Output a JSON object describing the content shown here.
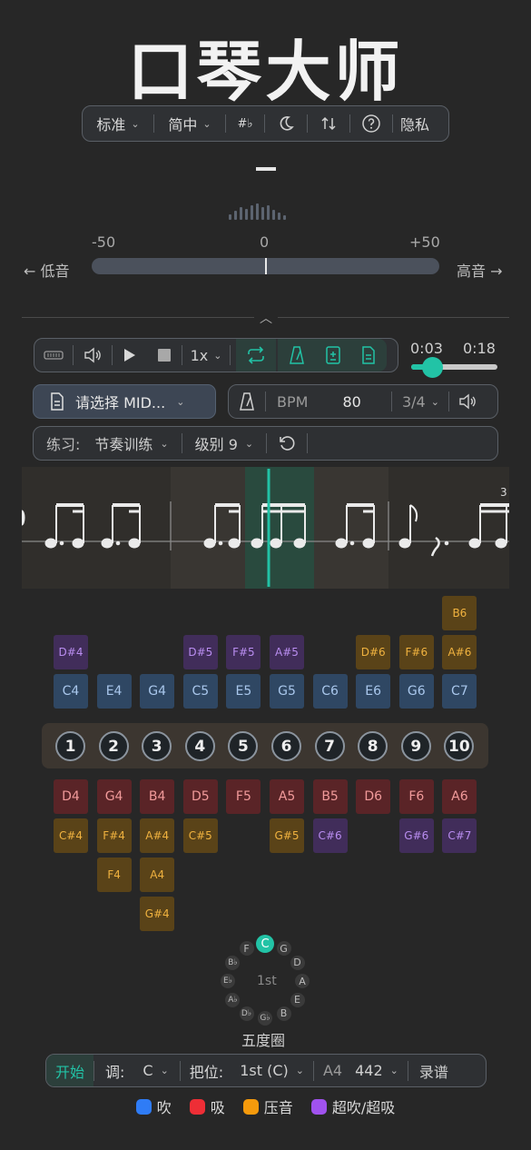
{
  "app": {
    "title": "口琴大师"
  },
  "topbar": {
    "harmonica_type": "标准",
    "language": "简中",
    "accidental_icon": "#♭",
    "privacy": "隐私"
  },
  "tuner": {
    "note": "—",
    "cents_min": "-50",
    "cents_mid": "0",
    "cents_max": "+50",
    "low_label": "← 低音",
    "high_label": "高音 →",
    "needle_cents": 0
  },
  "transport": {
    "speed": "1x",
    "time_current": "0:03",
    "time_total": "0:18",
    "progress": 0.17
  },
  "midi": {
    "label": "请选择 MID..."
  },
  "tempo": {
    "bpm_label": "BPM",
    "bpm_value": "80",
    "time_signature": "3/4"
  },
  "practice": {
    "label": "练习:",
    "mode": "节奏训练",
    "level": "级别 9"
  },
  "score": {
    "tuplet_label": "3"
  },
  "keys": {
    "blow": [
      "C4",
      "E4",
      "G4",
      "C5",
      "E5",
      "G5",
      "C6",
      "E6",
      "G6",
      "C7"
    ],
    "draw": [
      "D4",
      "G4",
      "B4",
      "D5",
      "F5",
      "A5",
      "B5",
      "D6",
      "F6",
      "A6"
    ],
    "blow_bends_overblows": [
      {
        "hole": 1,
        "row": 1,
        "note": "D#4",
        "kind": "over"
      },
      {
        "hole": 4,
        "row": 1,
        "note": "D#5",
        "kind": "over"
      },
      {
        "hole": 5,
        "row": 1,
        "note": "F#5",
        "kind": "over"
      },
      {
        "hole": 6,
        "row": 1,
        "note": "A#5",
        "kind": "over"
      },
      {
        "hole": 8,
        "row": 1,
        "note": "D#6",
        "kind": "bend"
      },
      {
        "hole": 9,
        "row": 1,
        "note": "F#6",
        "kind": "bend"
      },
      {
        "hole": 10,
        "row": 1,
        "note": "A#6",
        "kind": "bend"
      },
      {
        "hole": 10,
        "row": 2,
        "note": "B6",
        "kind": "bend"
      }
    ],
    "draw_bends_overdraws": [
      {
        "hole": 1,
        "row": 1,
        "note": "C#4",
        "kind": "bend"
      },
      {
        "hole": 2,
        "row": 1,
        "note": "F#4",
        "kind": "bend"
      },
      {
        "hole": 3,
        "row": 1,
        "note": "A#4",
        "kind": "bend"
      },
      {
        "hole": 4,
        "row": 1,
        "note": "C#5",
        "kind": "bend"
      },
      {
        "hole": 6,
        "row": 1,
        "note": "G#5",
        "kind": "bend"
      },
      {
        "hole": 7,
        "row": 1,
        "note": "C#6",
        "kind": "over"
      },
      {
        "hole": 9,
        "row": 1,
        "note": "G#6",
        "kind": "over"
      },
      {
        "hole": 10,
        "row": 1,
        "note": "C#7",
        "kind": "over"
      },
      {
        "hole": 2,
        "row": 2,
        "note": "F4",
        "kind": "bend"
      },
      {
        "hole": 3,
        "row": 2,
        "note": "A4",
        "kind": "bend"
      },
      {
        "hole": 3,
        "row": 3,
        "note": "G#4",
        "kind": "bend"
      }
    ],
    "holes": [
      "1",
      "2",
      "3",
      "4",
      "5",
      "6",
      "7",
      "8",
      "9",
      "10"
    ]
  },
  "circle_of_fifths": {
    "label": "五度圈",
    "center": "1st",
    "notes": [
      "C",
      "G",
      "D",
      "A",
      "E",
      "B",
      "G♭",
      "D♭",
      "A♭",
      "E♭",
      "B♭",
      "F"
    ],
    "selected": "C"
  },
  "bottombar": {
    "start": "开始",
    "key_label": "调:",
    "key_value": "C",
    "position_label": "把位:",
    "position_value": "1st (C)",
    "a4_label": "A4",
    "a4_value": "442",
    "record": "录谱"
  },
  "legend": [
    {
      "label": "吹",
      "color": "#2f7cf6"
    },
    {
      "label": "吸",
      "color": "#ee2e36"
    },
    {
      "label": "压音",
      "color": "#f59a0c"
    },
    {
      "label": "超吹/超吸",
      "color": "#a052ee"
    }
  ],
  "colors": {
    "accent": "#22c3a6"
  }
}
